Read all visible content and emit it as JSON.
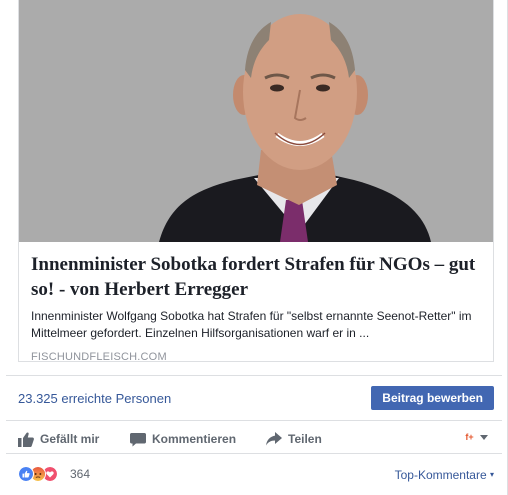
{
  "link_preview": {
    "title": "Innenminister Sobotka fordert Strafen für NGOs – gut so! - von Herbert Erregger",
    "description": "Innenminister Wolfgang Sobotka hat Strafen für \"selbst ernannte Seenot-Retter\" im Mittelmeer gefordert. Einzelnen Hilfsorganisationen warf er in ...",
    "domain": "FISCHUNDFLEISCH.COM"
  },
  "reach": {
    "text": "23.325 erreichte Personen",
    "boost_label": "Beitrag bewerben"
  },
  "actions": {
    "like_label": "Gefällt mir",
    "comment_label": "Kommentieren",
    "share_label": "Teilen"
  },
  "reactions": {
    "count": "364",
    "icons": [
      "like-reaction-icon",
      "angry-reaction-icon",
      "love-reaction-icon"
    ]
  },
  "comments_sort": {
    "label": "Top-Kommentare",
    "indicator": "▾"
  },
  "colors": {
    "link": "#365899",
    "button": "#4267b2",
    "muted": "#606770",
    "border": "#dddfe2"
  }
}
